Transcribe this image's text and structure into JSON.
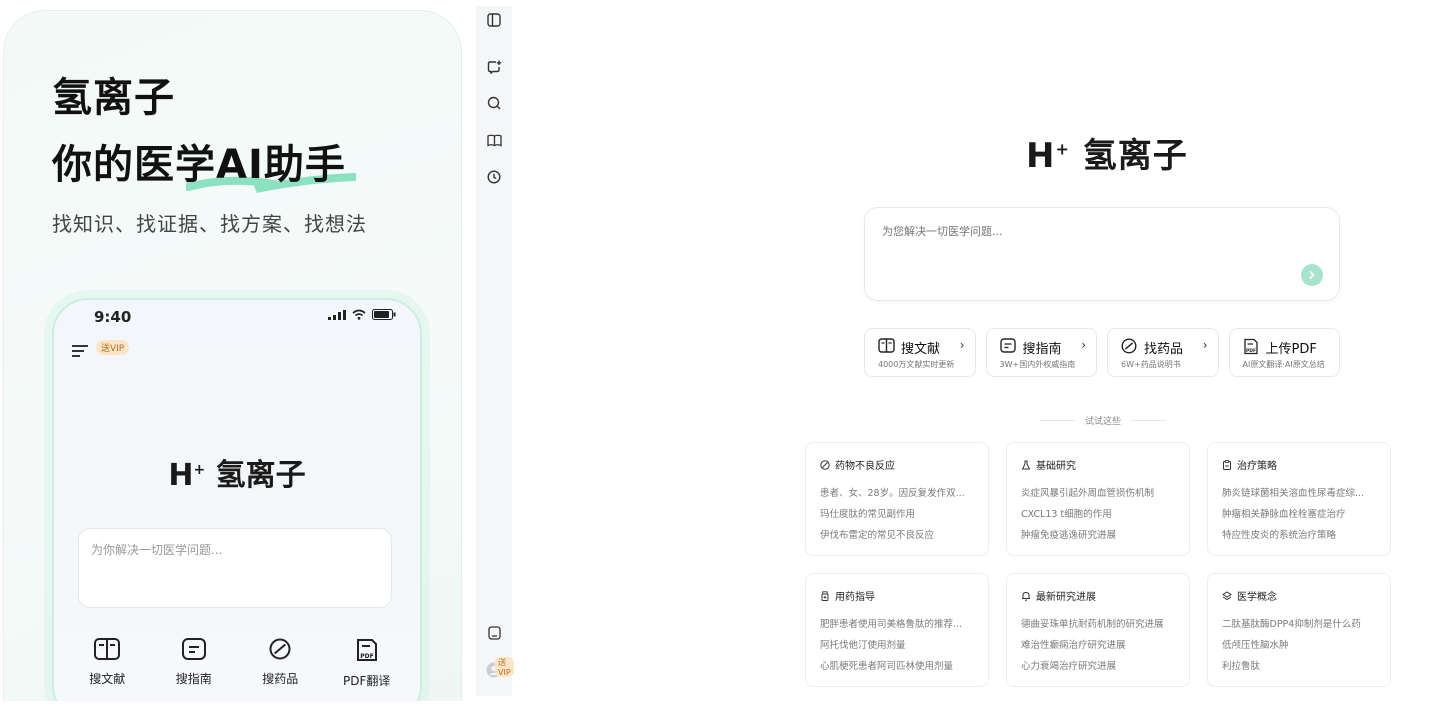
{
  "promo": {
    "title_line1": "氢离子",
    "title_line2": "你的医学AI助手",
    "subtitle": "找知识、找证据、找方案、找想法",
    "phone": {
      "time": "9:40",
      "vip_badge": "送VIP",
      "logo_mark": "H",
      "logo_sup": "+",
      "logo_text": "氢离子",
      "input_placeholder": "为你解决一切医学问题...",
      "shortcuts": [
        {
          "label": "搜文献",
          "icon": "book-icon"
        },
        {
          "label": "搜指南",
          "icon": "document-icon"
        },
        {
          "label": "搜药品",
          "icon": "pill-icon"
        },
        {
          "label": "PDF翻译",
          "icon": "pdf-icon"
        }
      ]
    }
  },
  "sidebar": {
    "items": [
      {
        "name": "sidebar-toggle-icon"
      },
      {
        "name": "new-chat-icon"
      },
      {
        "name": "search-icon"
      },
      {
        "name": "library-icon"
      },
      {
        "name": "history-icon"
      }
    ],
    "vip_badge": "送VIP"
  },
  "main": {
    "logo_mark": "H",
    "logo_sup": "+",
    "logo_text": "氢离子",
    "search_placeholder": "为您解决一切医学问题...",
    "features": [
      {
        "title": "搜文献",
        "desc": "4000万文献实时更新",
        "icon": "literature-icon",
        "arrow": "›"
      },
      {
        "title": "搜指南",
        "desc": "3W+国内外权威指南",
        "icon": "guide-icon",
        "arrow": "›"
      },
      {
        "title": "找药品",
        "desc": "6W+药品说明书",
        "icon": "drug-icon",
        "arrow": "›"
      },
      {
        "title": "上传PDF",
        "desc": "AI原文翻译·AI原文总结",
        "icon": "pdf-upload-icon",
        "arrow": ""
      }
    ],
    "try_label": "试试这些",
    "cards": [
      {
        "title": "药物不良反应",
        "icon": "adverse-reaction-icon",
        "items": [
          "患者、女、28岁。因反复发作双...",
          "玛仕度肽的常见副作用",
          "伊伐布雷定的常见不良反应"
        ]
      },
      {
        "title": "基础研究",
        "icon": "flask-icon",
        "items": [
          "炎症风暴引起外周血管损伤机制",
          "CXCL13 t细胞的作用",
          "肿瘤免疫逃逸研究进展"
        ]
      },
      {
        "title": "治疗策略",
        "icon": "clipboard-icon",
        "items": [
          "肺炎链球菌相关溶血性尿毒症综...",
          "肿瘤相关静脉血栓栓塞症治疗",
          "特应性皮炎的系统治疗策略"
        ]
      },
      {
        "title": "用药指导",
        "icon": "medicine-bottle-icon",
        "items": [
          "肥胖患者使用司美格鲁肽的推荐...",
          "阿托伐他汀使用剂量",
          "心肌梗死患者阿司匹林使用剂量"
        ]
      },
      {
        "title": "最新研究进展",
        "icon": "bell-icon",
        "items": [
          "德曲妥珠单抗耐药机制的研究进展",
          "难治性癫痫治疗研究进展",
          "心力衰竭治疗研究进展"
        ]
      },
      {
        "title": "医学概念",
        "icon": "concept-icon",
        "items": [
          "二肽基肽酶DPP4抑制剂是什么药",
          "低颅压性脑水肿",
          "利拉鲁肽"
        ]
      }
    ]
  }
}
